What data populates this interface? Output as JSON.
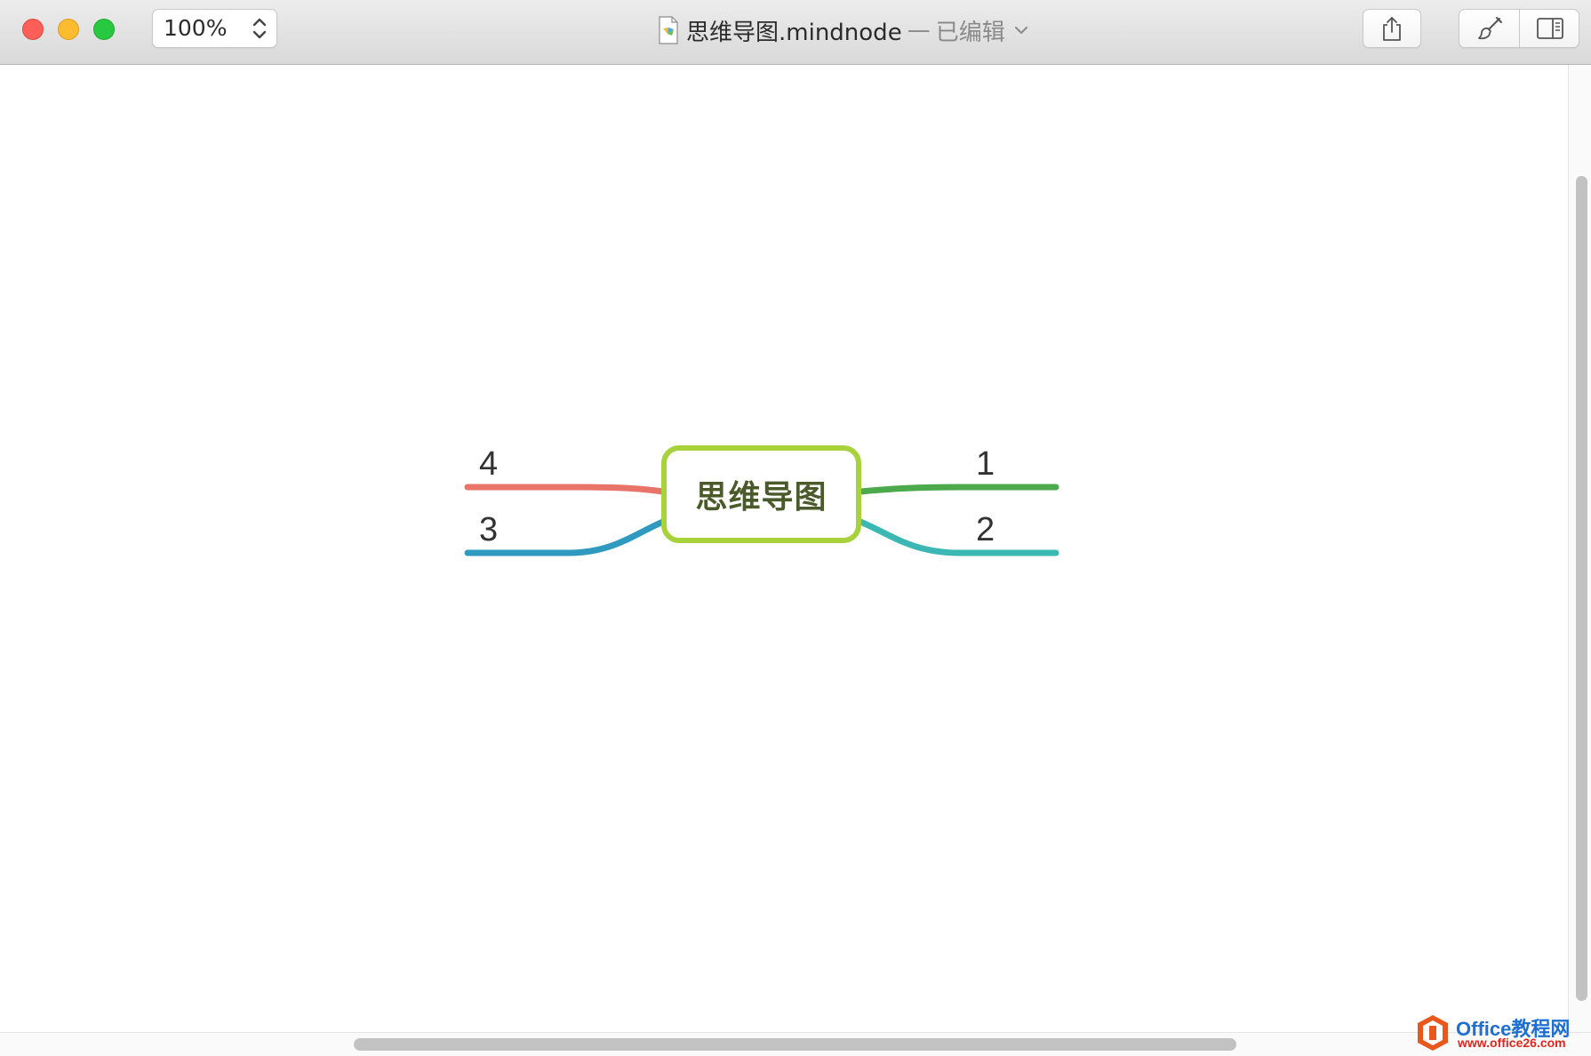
{
  "window": {
    "zoom": "100%",
    "title": "思维导图.mindnode",
    "separator": "—",
    "status": "已编辑"
  },
  "colors": {
    "central_border": "#a8d23c",
    "branch_1": "#4caa4c",
    "branch_2": "#3cb8b4",
    "branch_3": "#2e9ac0",
    "branch_4": "#e87368"
  },
  "icons": {
    "zoom_stepper": "up-down-chevron-icon",
    "document": "mindnode-document-icon",
    "title_menu": "chevron-down-icon",
    "share": "share-icon",
    "style": "brush-icon",
    "sidebar": "sidebar-toggle-icon"
  },
  "mindmap": {
    "central": "思维导图",
    "branches": [
      {
        "label": "1",
        "side": "right",
        "color": "#4caa4c"
      },
      {
        "label": "2",
        "side": "right",
        "color": "#3cb8b4"
      },
      {
        "label": "3",
        "side": "left",
        "color": "#2e9ac0"
      },
      {
        "label": "4",
        "side": "left",
        "color": "#e87368"
      }
    ]
  },
  "watermark": {
    "brand": "Office教程网",
    "url": "www.office26.com"
  }
}
